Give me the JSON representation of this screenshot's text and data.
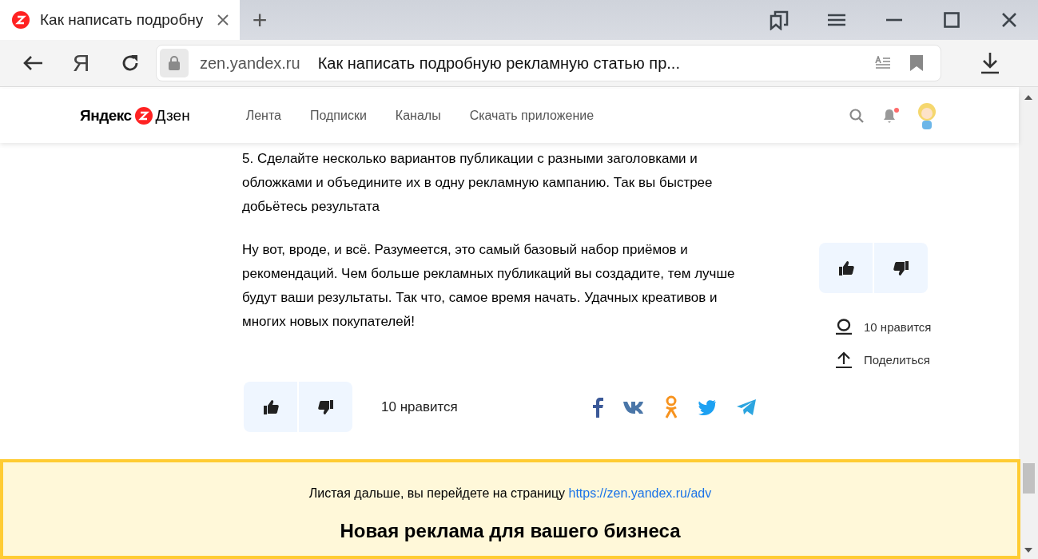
{
  "browser": {
    "tab": {
      "title": "Как написать подробну",
      "selected": true
    },
    "new_tab": "+",
    "yandex_button": "Я",
    "address": {
      "domain": "zen.yandex.ru",
      "page_title": "Как написать подробную рекламную статью пр..."
    }
  },
  "header": {
    "logo": {
      "left": "Яндекс",
      "right": "Дзен"
    },
    "nav": [
      {
        "label": "Лента"
      },
      {
        "label": "Подписки"
      },
      {
        "label": "Каналы"
      },
      {
        "label": "Скачать приложение"
      }
    ],
    "notifications": {
      "unread": true
    }
  },
  "article": {
    "paragraphs": [
      "5. Сделайте несколько вариантов публикации с разными заголовками и обложками и объедините их в одну рекламную кампанию. Так вы быстрее добьётесь результата",
      "Ну вот, вроде, и всё. Разумеется, это самый базовый набор приёмов и рекомендаций. Чем больше рекламных публикаций вы создадите, тем лучше будут ваши результаты. Так что, самое время начать. Удачных креативов и многих новых покупателей!"
    ],
    "likes": "10 нравится"
  },
  "sidebar": {
    "likes": "10 нравится",
    "share": "Поделиться"
  },
  "banner": {
    "text": "Листая дальше, вы перейдете на страницу",
    "link": "https://zen.yandex.ru/adv",
    "title": "Новая реклама для вашего бизнеса"
  }
}
